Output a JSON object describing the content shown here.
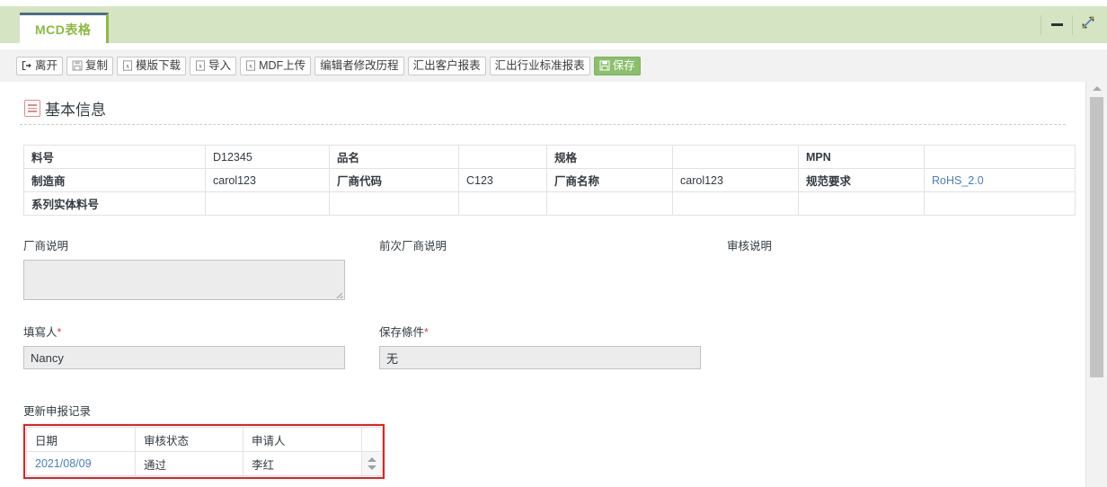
{
  "window": {
    "tab_label": "MCD表格",
    "minimize_icon": "minimize-icon",
    "maximize_icon": "maximize-expand-icon",
    "accent_green": "#8cba3f",
    "header_band": "#d5e5c3"
  },
  "toolbar": {
    "buttons": [
      {
        "label": "离开",
        "icon": "exit-arrow-icon",
        "primary": false
      },
      {
        "label": "复制",
        "icon": "copy-save-icon",
        "primary": false
      },
      {
        "label": "模版下载",
        "icon": "excel-x-icon",
        "primary": false
      },
      {
        "label": "导入",
        "icon": "excel-x-icon",
        "primary": false
      },
      {
        "label": "MDF上传",
        "icon": "excel-x-icon",
        "primary": false
      },
      {
        "label": "编辑者修改历程",
        "icon": "",
        "primary": false
      },
      {
        "label": "汇出客户报表",
        "icon": "",
        "primary": false
      },
      {
        "label": "汇出行业标准报表",
        "icon": "",
        "primary": false
      },
      {
        "label": "保存",
        "icon": "save-disk-icon",
        "primary": true
      }
    ]
  },
  "section": {
    "title": "基本信息",
    "icon": "list-document-icon"
  },
  "info_table": {
    "rows": [
      [
        {
          "text": "料号",
          "type": "label"
        },
        {
          "text": "D12345",
          "type": "value"
        },
        {
          "text": "品名",
          "type": "label"
        },
        {
          "text": "",
          "type": "value"
        },
        {
          "text": "规格",
          "type": "label"
        },
        {
          "text": "",
          "type": "value"
        },
        {
          "text": "MPN",
          "type": "label"
        },
        {
          "text": "",
          "type": "value"
        }
      ],
      [
        {
          "text": "制造商",
          "type": "label"
        },
        {
          "text": "carol123",
          "type": "value"
        },
        {
          "text": "厂商代码",
          "type": "label"
        },
        {
          "text": "C123",
          "type": "value"
        },
        {
          "text": "厂商名称",
          "type": "label"
        },
        {
          "text": "carol123",
          "type": "value"
        },
        {
          "text": "规范要求",
          "type": "label"
        },
        {
          "text": "RoHS_2.0",
          "type": "link"
        }
      ],
      [
        {
          "text": "系列实体料号",
          "type": "label"
        },
        {
          "text": "",
          "type": "value"
        },
        {
          "text": "",
          "type": "value"
        },
        {
          "text": "",
          "type": "value"
        },
        {
          "text": "",
          "type": "value"
        },
        {
          "text": "",
          "type": "value"
        },
        {
          "text": "",
          "type": "value"
        },
        {
          "text": "",
          "type": "value"
        }
      ]
    ]
  },
  "memo": {
    "vendor_note_label": "厂商说明",
    "vendor_note_value": "",
    "prev_vendor_note_label": "前次厂商说明",
    "prev_vendor_note_value": "",
    "review_note_label": "审核说明",
    "review_note_value": ""
  },
  "fields": {
    "filler_label": "填寫人",
    "filler_required": "*",
    "filler_value": "Nancy",
    "storage_label": "保存條件",
    "storage_required": "*",
    "storage_value": "无"
  },
  "record": {
    "caption": "更新申报记录",
    "highlight_color": "#ee1c1c",
    "headers": [
      "日期",
      "审核状态",
      "申请人",
      ""
    ],
    "rows": [
      {
        "date": "2021/08/09",
        "status": "通过",
        "applicant": "李红"
      }
    ],
    "spinner_up_icon": "spinner-up-icon",
    "spinner_down_icon": "spinner-down-icon"
  },
  "scrollbar": {
    "up_icon": "scroll-up-arrow-icon"
  }
}
